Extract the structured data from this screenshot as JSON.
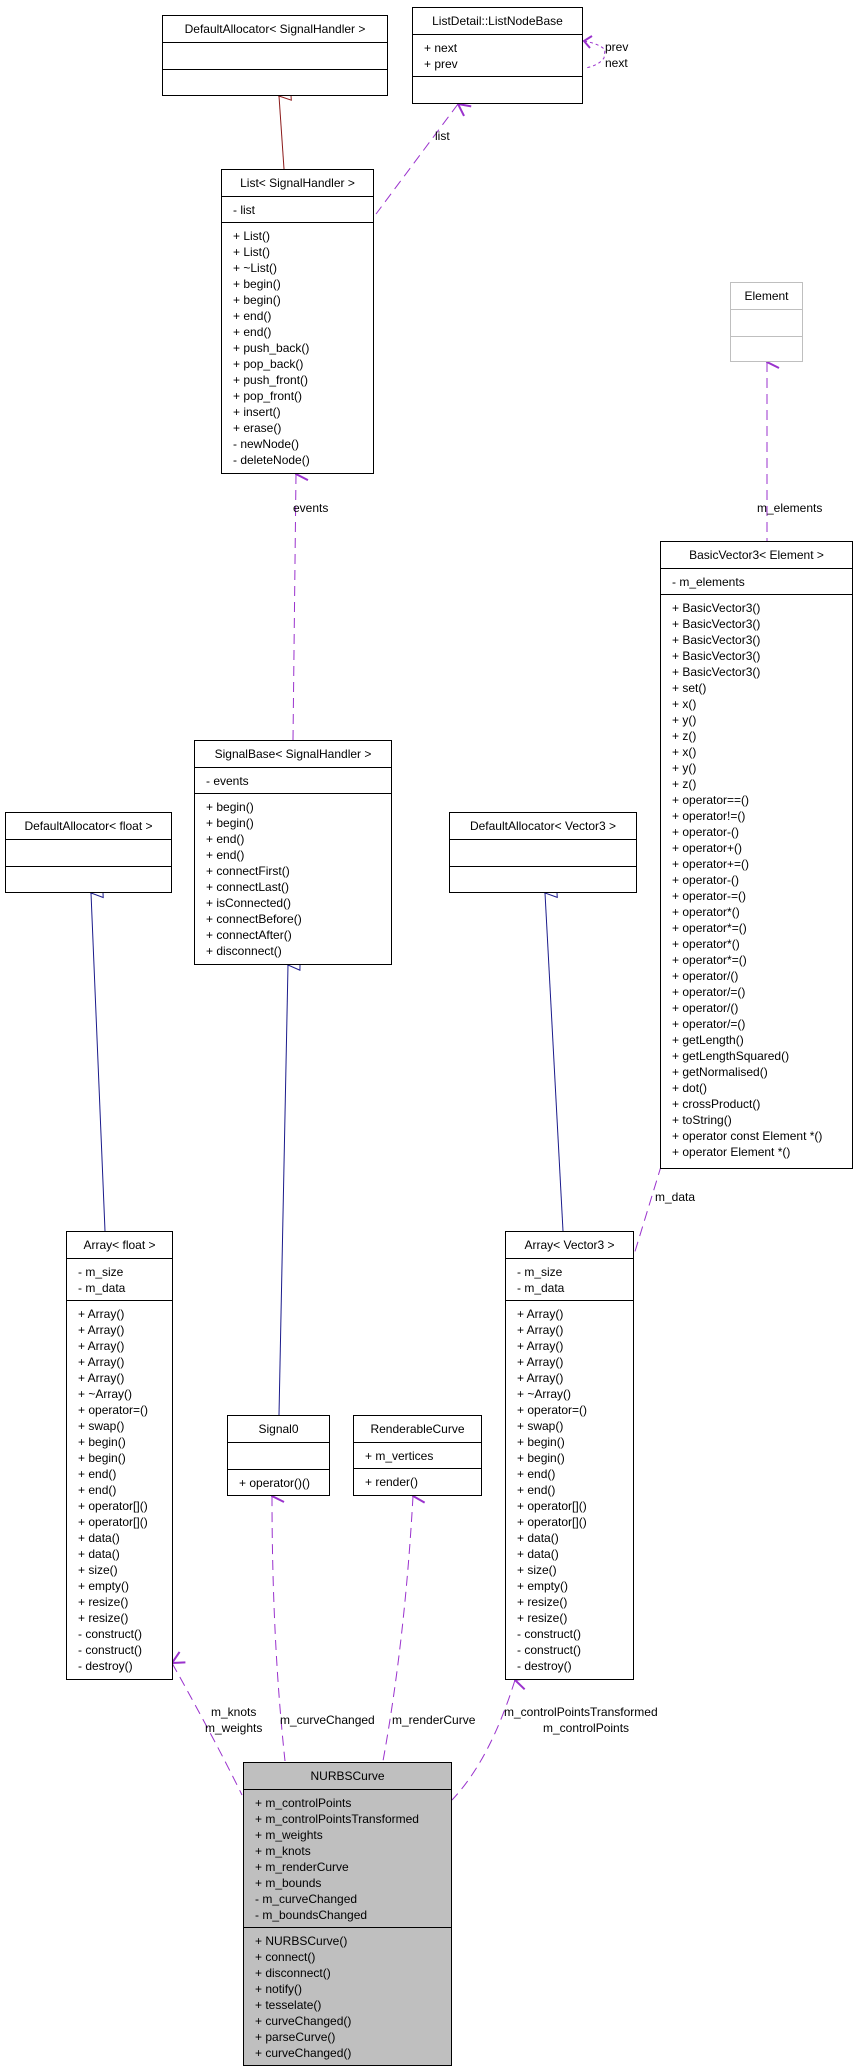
{
  "colors": {
    "inheritance_red": "#8b1a1a",
    "inheritance_blue": "#1a1a8b",
    "usage": "#9a32cd",
    "highlight": "#bfbfbf"
  },
  "classes": [
    {
      "id": "default-allocator-signalhandler",
      "name": "DefaultAllocator< SignalHandler >",
      "attributes": [],
      "methods": []
    },
    {
      "id": "listnodebase",
      "name": "ListDetail::ListNodeBase",
      "attributes": [
        "+ next",
        "+ prev"
      ],
      "methods": []
    },
    {
      "id": "list-signalhandler",
      "name": "List< SignalHandler >",
      "attributes": [
        "- list"
      ],
      "methods": [
        "+ List()",
        "+ List()",
        "+ ~List()",
        "+ begin()",
        "+ begin()",
        "+ end()",
        "+ end()",
        "+ push_back()",
        "+ pop_back()",
        "+ push_front()",
        "+ pop_front()",
        "+ insert()",
        "+ erase()",
        "- newNode()",
        "- deleteNode()"
      ]
    },
    {
      "id": "element",
      "name": "Element",
      "attributes": [],
      "methods": []
    },
    {
      "id": "basicvector3-element",
      "name": "BasicVector3< Element >",
      "attributes": [
        "- m_elements"
      ],
      "methods": [
        "+ BasicVector3()",
        "+ BasicVector3()",
        "+ BasicVector3()",
        "+ BasicVector3()",
        "+ BasicVector3()",
        "+ set()",
        "+ x()",
        "+ y()",
        "+ z()",
        "+ x()",
        "+ y()",
        "+ z()",
        "+ operator==()",
        "+ operator!=()",
        "+ operator-()",
        "+ operator+()",
        "+ operator+=()",
        "+ operator-()",
        "+ operator-=()",
        "+ operator*()",
        "+ operator*=()",
        "+ operator*()",
        "+ operator*=()",
        "+ operator/()",
        "+ operator/=()",
        "+ operator/()",
        "+ operator/=()",
        "+ getLength()",
        "+ getLengthSquared()",
        "+ getNormalised()",
        "+ dot()",
        "+ crossProduct()",
        "+ toString()",
        "+ operator const Element *()",
        "+ operator Element *()"
      ]
    },
    {
      "id": "signalbase-signalhandler",
      "name": "SignalBase< SignalHandler >",
      "attributes": [
        "- events"
      ],
      "methods": [
        "+ begin()",
        "+ begin()",
        "+ end()",
        "+ end()",
        "+ connectFirst()",
        "+ connectLast()",
        "+ isConnected()",
        "+ connectBefore()",
        "+ connectAfter()",
        "+ disconnect()"
      ]
    },
    {
      "id": "default-allocator-float",
      "name": "DefaultAllocator< float >",
      "attributes": [],
      "methods": []
    },
    {
      "id": "default-allocator-vector3",
      "name": "DefaultAllocator< Vector3 >",
      "attributes": [],
      "methods": []
    },
    {
      "id": "array-float",
      "name": "Array< float >",
      "attributes": [
        "- m_size",
        "- m_data"
      ],
      "methods": [
        "+ Array()",
        "+ Array()",
        "+ Array()",
        "+ Array()",
        "+ Array()",
        "+ ~Array()",
        "+ operator=()",
        "+ swap()",
        "+ begin()",
        "+ begin()",
        "+ end()",
        "+ end()",
        "+ operator[]()",
        "+ operator[]()",
        "+ data()",
        "+ data()",
        "+ size()",
        "+ empty()",
        "+ resize()",
        "+ resize()",
        "- construct()",
        "- construct()",
        "- destroy()"
      ]
    },
    {
      "id": "array-vector3",
      "name": "Array< Vector3 >",
      "attributes": [
        "- m_size",
        "- m_data"
      ],
      "methods": [
        "+ Array()",
        "+ Array()",
        "+ Array()",
        "+ Array()",
        "+ Array()",
        "+ ~Array()",
        "+ operator=()",
        "+ swap()",
        "+ begin()",
        "+ begin()",
        "+ end()",
        "+ end()",
        "+ operator[]()",
        "+ operator[]()",
        "+ data()",
        "+ data()",
        "+ size()",
        "+ empty()",
        "+ resize()",
        "+ resize()",
        "- construct()",
        "- construct()",
        "- destroy()"
      ]
    },
    {
      "id": "signal0",
      "name": "Signal0",
      "attributes": [],
      "methods": [
        "+ operator()()"
      ]
    },
    {
      "id": "renderablecurve",
      "name": "RenderableCurve",
      "attributes": [
        "+ m_vertices"
      ],
      "methods": [
        "+ render()"
      ]
    },
    {
      "id": "nurbscurve",
      "name": "NURBSCurve",
      "attributes": [
        "+ m_controlPoints",
        "+ m_controlPointsTransformed",
        "+ m_weights",
        "+ m_knots",
        "+ m_renderCurve",
        "+ m_bounds",
        "- m_curveChanged",
        "- m_boundsChanged"
      ],
      "methods": [
        "+ NURBSCurve()",
        "+ connect()",
        "+ disconnect()",
        "+ notify()",
        "+ tesselate()",
        "+ curveChanged()",
        "+ parseCurve()",
        "+ curveChanged()"
      ]
    }
  ],
  "edge_labels": {
    "list": "list",
    "prev": "prev",
    "next": "next",
    "events": "events",
    "m_elements": "m_elements",
    "m_data": "m_data",
    "m_knots": "m_knots",
    "m_weights": "m_weights",
    "m_curveChanged": "m_curveChanged",
    "m_renderCurve": "m_renderCurve",
    "m_controlPointsTransformed": "m_controlPointsTransformed",
    "m_controlPoints": "m_controlPoints"
  }
}
